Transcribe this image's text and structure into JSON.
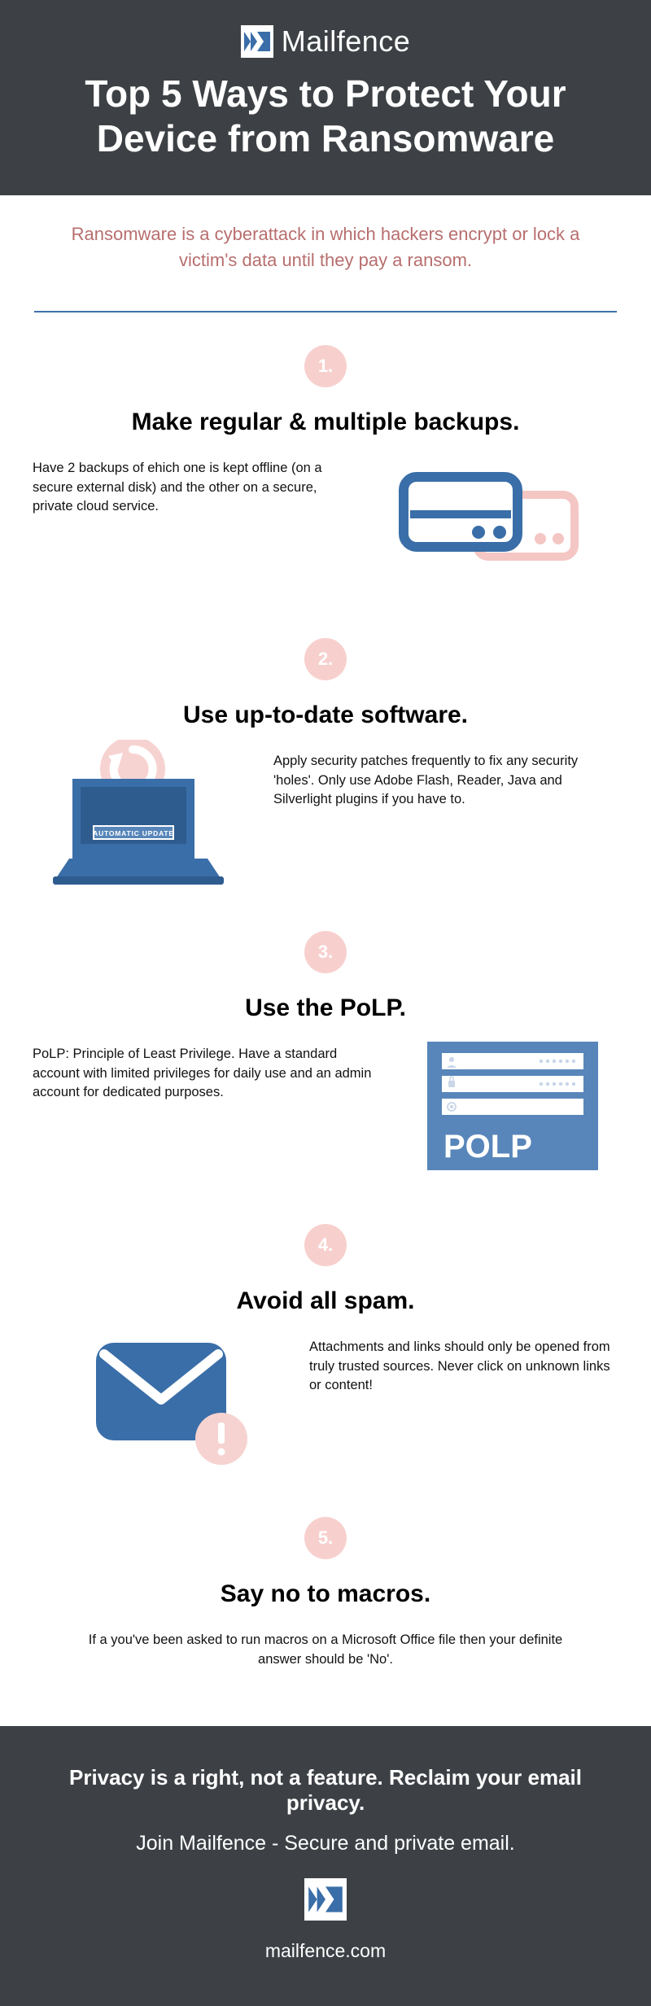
{
  "brand": "Mailfence",
  "title": "Top 5 Ways to Protect Your Device from Ransomware",
  "intro": "Ransomware is a cyberattack in which hackers encrypt or lock a victim's data until they pay a ransom.",
  "sections": [
    {
      "num": "1.",
      "title": "Make regular & multiple backups.",
      "text": "Have 2 backups of ehich one is kept offline (on a secure external disk) and the other on a secure, private cloud service."
    },
    {
      "num": "2.",
      "title": "Use up-to-date software.",
      "text": "Apply security patches frequently to fix any security 'holes'. Only use Adobe Flash, Reader, Java and Silverlight plugins if you have to.",
      "ill_label": "AUTOMATIC UPDATE"
    },
    {
      "num": "3.",
      "title": "Use the PoLP.",
      "text": "PoLP: Principle of Least Privilege. Have a standard account with limited privileges for daily use and an admin account for dedicated purposes.",
      "ill_label": "POLP"
    },
    {
      "num": "4.",
      "title": "Avoid all spam.",
      "text": "Attachments and links should only be opened from truly trusted sources. Never click on unknown links or content!"
    },
    {
      "num": "5.",
      "title": "Say no to macros.",
      "text": "If a you've been asked to run macros on a Microsoft Office file then your definite answer should be 'No'."
    }
  ],
  "footer": {
    "line1": "Privacy is a right, not a feature. Reclaim your email privacy.",
    "line2": "Join Mailfence -  Secure and private email.",
    "site": "mailfence.com"
  }
}
